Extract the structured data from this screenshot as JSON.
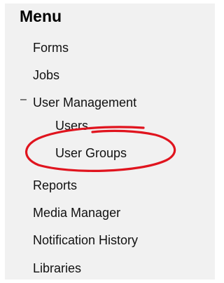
{
  "menu": {
    "title": "Menu",
    "items": [
      {
        "label": "Forms"
      },
      {
        "label": "Jobs"
      },
      {
        "label": "User Management",
        "expanded": true,
        "toggle_icon": "collapse-minus-icon",
        "toggle_glyph": "–",
        "children": [
          {
            "label": "Users"
          },
          {
            "label": "User Groups",
            "highlighted": true
          }
        ]
      },
      {
        "label": "Reports"
      },
      {
        "label": "Media Manager"
      },
      {
        "label": "Notification History"
      },
      {
        "label": "Libraries"
      }
    ]
  },
  "annotation": {
    "color": "#e0141e",
    "shape": "hand-drawn-circle",
    "target": "User Groups"
  }
}
